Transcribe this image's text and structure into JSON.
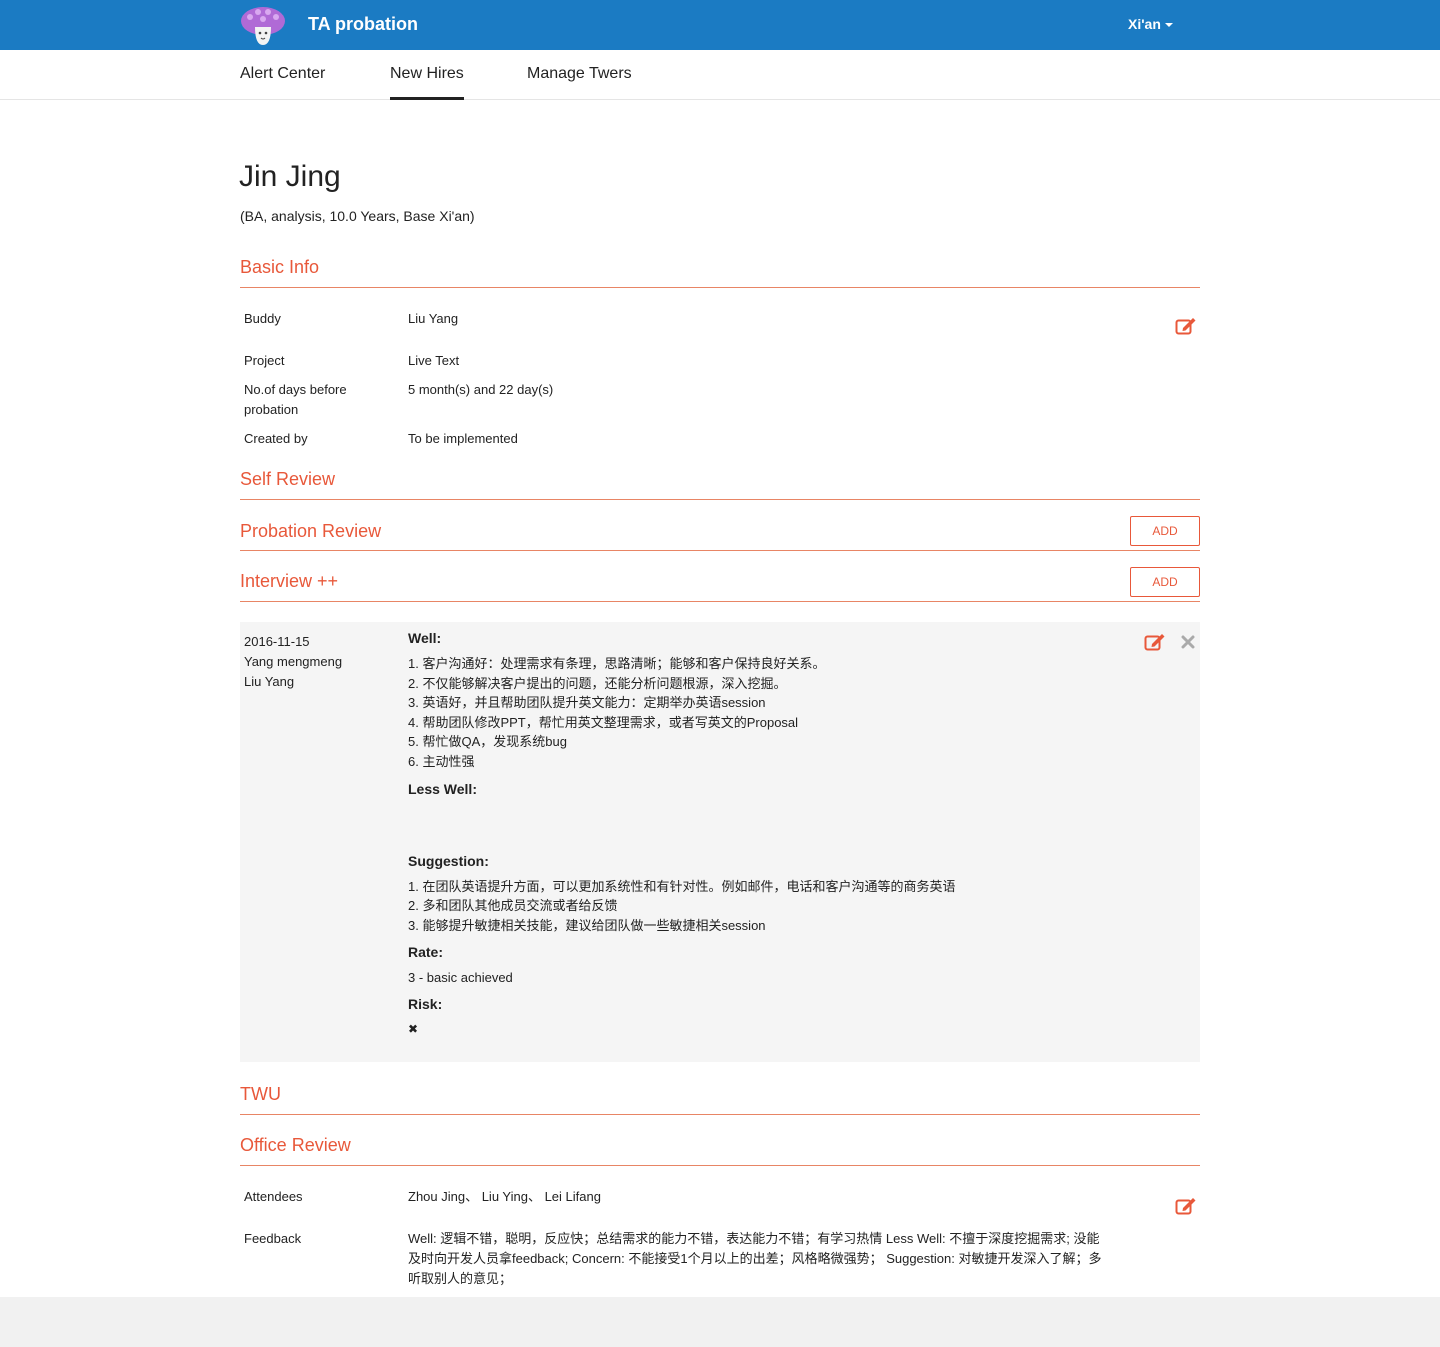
{
  "header": {
    "app_title": "TA probation",
    "city": "Xi'an"
  },
  "nav": {
    "items": [
      "Alert Center",
      "New Hires",
      "Manage Twers"
    ],
    "active": "New Hires"
  },
  "person": {
    "name": "Jin Jing",
    "subtitle": "(BA, analysis, 10.0 Years, Base Xi'an)"
  },
  "basic_info": {
    "title": "Basic Info",
    "rows": [
      {
        "label": "Buddy",
        "value": "Liu Yang"
      },
      {
        "label": "Project",
        "value": "Live Text"
      },
      {
        "label": "No.of days before\nprobation",
        "value": "5 month(s) and 22 day(s)"
      },
      {
        "label": "Created by",
        "value": "To be implemented"
      }
    ]
  },
  "self_review": {
    "title": "Self Review"
  },
  "probation_review": {
    "title": "Probation Review",
    "add_label": "ADD"
  },
  "interview": {
    "title": "Interview ++",
    "add_label": "ADD",
    "entry": {
      "date": "2016-11-15",
      "interviewer": "Yang mengmeng",
      "buddy": "Liu Yang",
      "well_title": "Well:",
      "well_lines": [
        "1. 客户沟通好：处理需求有条理，思路清晰；能够和客户保持良好关系。",
        "2. 不仅能够解决客户提出的问题，还能分析问题根源，深入挖掘。",
        "3. 英语好，并且帮助团队提升英文能力：定期举办英语session",
        "4. 帮助团队修改PPT，帮忙用英文整理需求，或者写英文的Proposal",
        "5. 帮忙做QA，发现系统bug",
        "6. 主动性强"
      ],
      "less_well_title": "Less Well:",
      "suggestion_title": "Suggestion:",
      "suggestion_lines": [
        "1. 在团队英语提升方面，可以更加系统性和有针对性。例如邮件，电话和客户沟通等的商务英语",
        "2. 多和团队其他成员交流或者给反馈",
        "3. 能够提升敏捷相关技能，建议给团队做一些敏捷相关session"
      ],
      "rate_title": "Rate:",
      "rate_value": "3 - basic achieved",
      "risk_title": "Risk:",
      "risk_value": "✖"
    }
  },
  "twu": {
    "title": "TWU"
  },
  "office_review": {
    "title": "Office Review",
    "attendees_label": "Attendees",
    "attendees_value": "Zhou Jing、 Liu Ying、 Lei Lifang",
    "feedback_label": "Feedback",
    "feedback_lines": [
      "Well: 逻辑不错，聪明，反应快；总结需求的能力不错，表达能力不错；有学习热情 Less Well: 不擅于深度挖掘需求; 没能",
      "及时向开发人员拿feedback; Concern: 不能接受1个月以上的出差；风格略微强势； Suggestion: 对敏捷开发深入了解；多",
      "听取别人的意见；"
    ]
  },
  "colors": {
    "header_bg": "#1b7bc3",
    "accent": "#e8583a",
    "card_bg": "#f5f5f5"
  }
}
